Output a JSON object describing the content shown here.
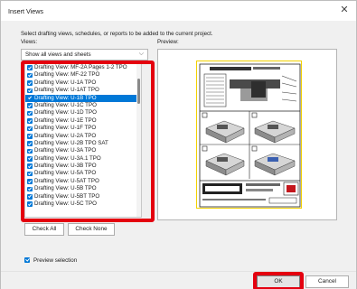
{
  "window": {
    "title": "Insert Views",
    "close_glyph": "✕"
  },
  "instruction": "Select drafting views, schedules, or reports to be added to the current project.",
  "views_label": "Views:",
  "preview_label": "Preview:",
  "filter": {
    "value": "Show all views and sheets"
  },
  "views": [
    "Drafting View: MF-2A Pages 1-2 TPO",
    "Drafting View: MF-22 TPO",
    "Drafting View: U-1A TPO",
    "Drafting View: U-1AT TPO",
    "Drafting View: U-1B TPO",
    "Drafting View: U-1C TPO",
    "Drafting View: U-1D TPO",
    "Drafting View: U-1E TPO",
    "Drafting View: U-1F TPO",
    "Drafting View: U-2A TPO",
    "Drafting View: U-2B TPO SAT",
    "Drafting View: U-3A TPO",
    "Drafting View: U-3A.1 TPO",
    "Drafting View: U-3B TPO",
    "Drafting View: U-5A TPO",
    "Drafting View: U-5AT TPO",
    "Drafting View: U-5B TPO",
    "Drafting View: U-5BT TPO",
    "Drafting View: U-5C TPO"
  ],
  "selected_index": 4,
  "buttons": {
    "check_all": "Check All",
    "check_none": "Check None",
    "ok": "OK",
    "cancel": "Cancel"
  },
  "preview_selection": {
    "label": "Preview selection",
    "checked": true
  },
  "colors": {
    "accent": "#0078d7",
    "highlight_red": "#e4000f",
    "sheet_border": "#f2d100"
  },
  "icons": {
    "close": "close-icon",
    "dropdown": "chevron-down-icon",
    "checkbox": "checkbox-checked-icon"
  }
}
